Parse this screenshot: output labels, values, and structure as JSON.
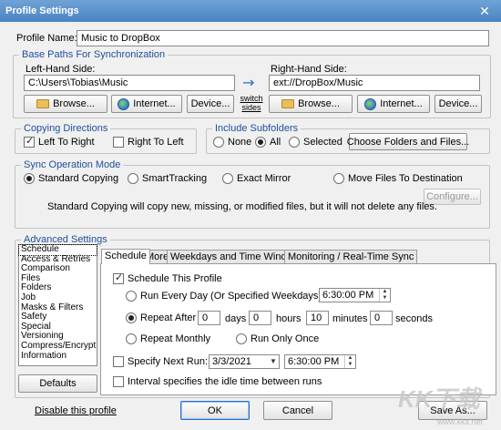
{
  "window": {
    "title": "Profile Settings",
    "close_glyph": "✕"
  },
  "profile": {
    "name_label": "Profile Name:",
    "name_value": "Music to DropBox"
  },
  "base_paths": {
    "legend": "Base Paths For Synchronization",
    "left_label": "Left-Hand Side:",
    "left_value": "C:\\Users\\Tobias\\Music",
    "right_label": "Right-Hand Side:",
    "right_value": "ext://DropBox/Music",
    "browse_label": "Browse...",
    "internet_label": "Internet...",
    "device_label": "Device...",
    "switch_line1": "switch",
    "switch_line2": "sides",
    "arrow_glyph": "→"
  },
  "copying_directions": {
    "legend": "Copying Directions",
    "left_to_right": "Left To Right",
    "right_to_left": "Right To Left"
  },
  "include_subfolders": {
    "legend": "Include Subfolders",
    "none": "None",
    "all": "All",
    "selected": "Selected",
    "choose_button": "Choose Folders and Files..."
  },
  "sync_mode": {
    "legend": "Sync Operation Mode",
    "standard": "Standard Copying",
    "smart": "SmartTracking",
    "exact": "Exact Mirror",
    "move": "Move Files To Destination",
    "configure": "Configure...",
    "description": "Standard Copying will copy new, missing, or modified files, but it will not delete any files."
  },
  "advanced": {
    "legend": "Advanced Settings",
    "categories": [
      "Schedule",
      "Access & Retries",
      "Comparison",
      "Files",
      "Folders",
      "Job",
      "Masks & Filters",
      "Safety",
      "Special",
      "Versioning",
      "Compress/Encrypt",
      "Information"
    ],
    "defaults_button": "Defaults",
    "tabs": [
      "Schedule",
      "More",
      "Weekdays and Time Window",
      "Monitoring / Real-Time Sync"
    ],
    "schedule_this_profile": "Schedule This Profile",
    "run_every_day": "Run Every Day (Or Specified Weekdays) At",
    "run_every_day_time": "6:30:00 PM",
    "repeat_after": "Repeat After",
    "repeat_days": "0",
    "days_label": "days",
    "repeat_hours": "0",
    "hours_label": "hours",
    "repeat_minutes": "10",
    "minutes_label": "minutes",
    "repeat_seconds": "0",
    "seconds_label": "seconds",
    "repeat_monthly": "Repeat Monthly",
    "run_only_once": "Run Only Once",
    "specify_next_run": "Specify Next Run:",
    "next_run_date": "3/3/2021",
    "next_run_time": "6:30:00 PM",
    "interval_idle": "Interval specifies the idle time between runs"
  },
  "footer": {
    "disable_link": "Disable this profile",
    "ok": "OK",
    "cancel": "Cancel",
    "save_as": "Save As..."
  },
  "watermark": {
    "brand": "KK下载",
    "url": "www.kkx.net"
  }
}
